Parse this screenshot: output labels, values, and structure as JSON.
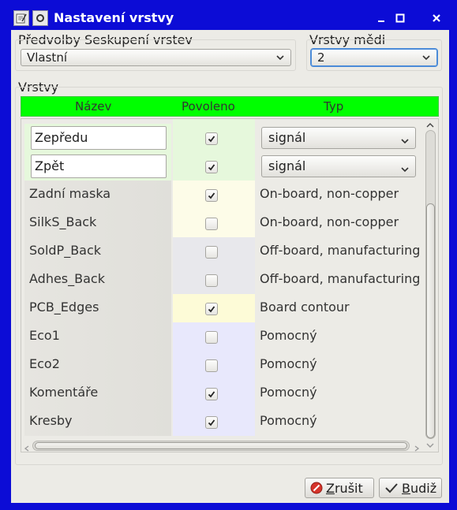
{
  "window": {
    "title": "Nastavení vrstvy"
  },
  "presets": {
    "label": "Předvolby Seskupení vrstev",
    "value": "Vlastní"
  },
  "copper": {
    "label": "Vrstvy mědi",
    "value": "2"
  },
  "layers": {
    "label": "Vrstvy",
    "header": {
      "name": "Název",
      "enabled": "Povoleno",
      "type": "Typ"
    },
    "rows": [
      {
        "name": "Zepředu",
        "enabled": true,
        "type": "signál",
        "editable": true
      },
      {
        "name": "Zpět",
        "enabled": true,
        "type": "signál",
        "editable": true
      },
      {
        "name": "Zadní maska",
        "enabled": true,
        "type": "On-board, non-copper"
      },
      {
        "name": "SilkS_Back",
        "enabled": false,
        "type": "On-board, non-copper"
      },
      {
        "name": "SoldP_Back",
        "enabled": false,
        "type": "Off-board, manufacturing"
      },
      {
        "name": "Adhes_Back",
        "enabled": false,
        "type": "Off-board, manufacturing"
      },
      {
        "name": "PCB_Edges",
        "enabled": true,
        "type": "Board contour"
      },
      {
        "name": "Eco1",
        "enabled": false,
        "type": "Pomocný"
      },
      {
        "name": "Eco2",
        "enabled": false,
        "type": "Pomocný"
      },
      {
        "name": "Komentáře",
        "enabled": true,
        "type": "Pomocný"
      },
      {
        "name": "Kresby",
        "enabled": true,
        "type": "Pomocný"
      }
    ]
  },
  "buttons": {
    "cancel_underlined": "Z",
    "cancel_rest": "rušit",
    "ok_underlined": "B",
    "ok_rest": "udiž"
  },
  "colors": {
    "header": "#00ff00",
    "copper": "#e6f8dc",
    "tech_nonCopper": "#fdfce8",
    "tech_manufacturing": "#e8e8ec",
    "board_edge": "#fdfbd7",
    "user": "#e8e8fc"
  }
}
